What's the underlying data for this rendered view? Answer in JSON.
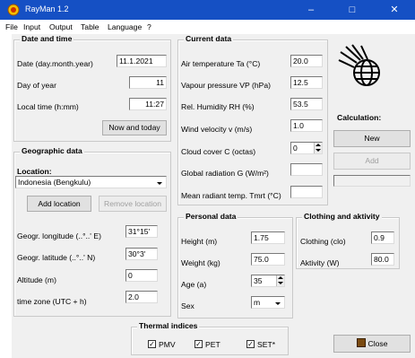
{
  "window": {
    "title": "RayMan 1.2",
    "min": "–",
    "max": "□",
    "close": "✕"
  },
  "menu": [
    "File",
    "Input",
    "Output",
    "Table",
    "Language",
    "?"
  ],
  "date_time": {
    "title": "Date and time",
    "date_label": "Date (day.month.year)",
    "date_value": "11.1.2021",
    "day_label": "Day of year",
    "day_value": "11",
    "time_label": "Local time (h:mm)",
    "time_value": "11:27",
    "now_button": "Now and today"
  },
  "geo": {
    "title": "Geographic data",
    "location_label": "Location:",
    "location_value": "Indonesia (Bengkulu)",
    "add_button": "Add location",
    "remove_button": "Remove location",
    "lon_label": "Geogr. longitude (..°..' E)",
    "lon_value": "31°15'",
    "lat_label": "Geogr. latitude (..°..' N)",
    "lat_value": "30°3'",
    "alt_label": "Altitude (m)",
    "alt_value": "0",
    "tz_label": "time zone (UTC + h)",
    "tz_value": "2.0"
  },
  "current": {
    "title": "Current data",
    "ta_label": "Air temperature Ta (°C)",
    "ta_value": "20.0",
    "vp_label": "Vapour pressure VP (hPa)",
    "vp_value": "12.5",
    "rh_label": "Rel. Humidity RH (%)",
    "rh_value": "53.5",
    "wind_label": "Wind velocity v (m/s)",
    "wind_value": "1.0",
    "cloud_label": "Cloud cover C (octas)",
    "cloud_value": "0",
    "glob_label": "Global radiation G (W/m²)",
    "glob_value": "",
    "tmrt_label": "Mean radiant temp. Tmrt (°C)",
    "tmrt_value": ""
  },
  "calc": {
    "label": "Calculation:",
    "new_button": "New",
    "add_button": "Add"
  },
  "personal": {
    "title": "Personal data",
    "height_label": "Height (m)",
    "height_value": "1.75",
    "weight_label": "Weight (kg)",
    "weight_value": "75.0",
    "age_label": "Age (a)",
    "age_value": "35",
    "sex_label": "Sex",
    "sex_value": "m"
  },
  "clothing": {
    "title": "Clothing and aktivity",
    "clo_label": "Clothing (clo)",
    "clo_value": "0.9",
    "act_label": "Aktivity (W)",
    "act_value": "80.0"
  },
  "thermal": {
    "title": "Thermal indices",
    "pmv": "PMV",
    "pet": "PET",
    "set": "SET*",
    "pmv_checked": true,
    "pet_checked": true,
    "set_checked": true
  },
  "close_button": "Close",
  "colors": {
    "titlebar": "#1550c4",
    "client": "#f0f0f0"
  }
}
